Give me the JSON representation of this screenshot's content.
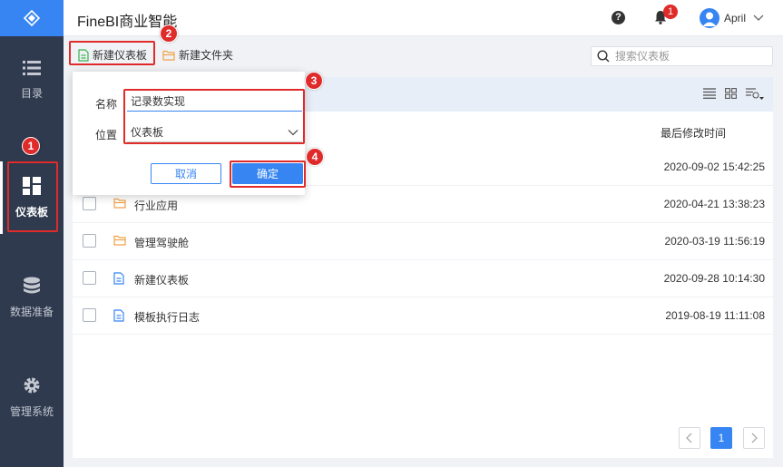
{
  "app": {
    "title": "FineBI商业智能"
  },
  "header": {
    "notification_count": "1",
    "user_name": "April",
    "help_glyph": "?"
  },
  "sidebar": {
    "items": [
      {
        "label": "目录",
        "icon": "list-icon"
      },
      {
        "label": "仪表板",
        "icon": "dashboard-icon",
        "active": true
      },
      {
        "label": "数据准备",
        "icon": "database-icon"
      },
      {
        "label": "管理系统",
        "icon": "gear-icon"
      }
    ]
  },
  "toolbar": {
    "new_dashboard_label": "新建仪表板",
    "new_folder_label": "新建文件夹",
    "search_placeholder": "搜索仪表板"
  },
  "table": {
    "modified_header": "最后修改时间",
    "rows": [
      {
        "name": "",
        "type": "folder",
        "modified": "2020-09-02 15:42:25"
      },
      {
        "name": "行业应用",
        "type": "folder",
        "modified": "2020-04-21 13:38:23"
      },
      {
        "name": "管理驾驶舱",
        "type": "folder",
        "modified": "2020-03-19 11:56:19"
      },
      {
        "name": "新建仪表板",
        "type": "file",
        "modified": "2020-09-28 10:14:30"
      },
      {
        "name": "模板执行日志",
        "type": "file",
        "modified": "2019-08-19 11:11:08"
      }
    ]
  },
  "dialog": {
    "name_label": "名称",
    "name_value": "记录数实现",
    "location_label": "位置",
    "location_value": "仪表板",
    "cancel_label": "取消",
    "ok_label": "确定"
  },
  "pagination": {
    "current_page": "1"
  },
  "annotations": {
    "step1": "1",
    "step2": "2",
    "step3": "3",
    "step4": "4"
  },
  "colors": {
    "accent": "#3685f2",
    "sidebar_bg": "#2f3a4e",
    "highlight": "#e02b2b",
    "folder": "#f0a24a"
  }
}
